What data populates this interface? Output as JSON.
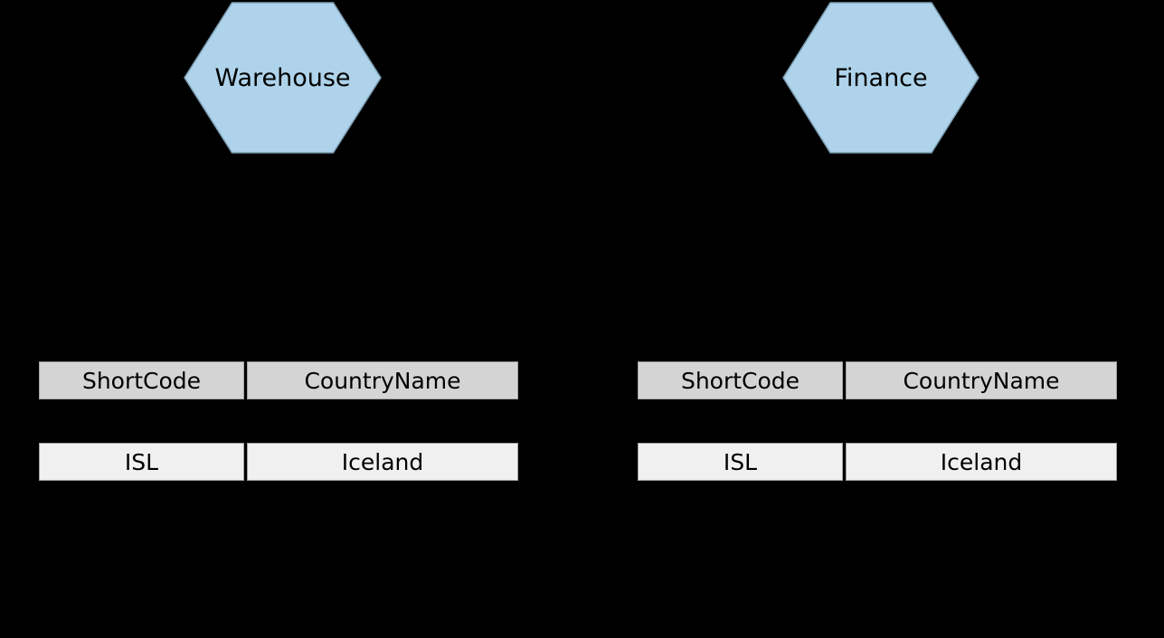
{
  "diagram": {
    "background_color": "#000000",
    "node_fill_color": "#aed3ea",
    "node_stroke_color": "#7d9fb5",
    "header_cell_color": "#d4d4d4",
    "data_cell_color": "#f0f0f0",
    "cell_border_color": "#a3a3a3",
    "text_color": "#000000"
  },
  "nodes": [
    {
      "id": "warehouse",
      "label": "Warehouse",
      "shape": "hexagon"
    },
    {
      "id": "finance",
      "label": "Finance",
      "shape": "hexagon"
    }
  ],
  "tables": [
    {
      "id": "warehouse-table",
      "owner": "Warehouse",
      "columns": [
        "ShortCode",
        "CountryName"
      ],
      "rows": [
        [
          "ISL",
          "Iceland"
        ]
      ]
    },
    {
      "id": "finance-table",
      "owner": "Finance",
      "columns": [
        "ShortCode",
        "CountryName"
      ],
      "rows": [
        [
          "ISL",
          "Iceland"
        ]
      ]
    }
  ]
}
